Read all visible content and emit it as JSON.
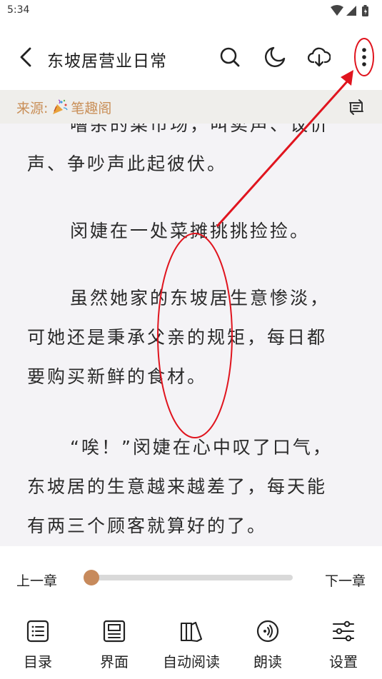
{
  "status_bar": {
    "time": "5:34"
  },
  "header": {
    "title": "东坡居营业日常"
  },
  "source": {
    "label": "来源:",
    "name": "笔趣阁"
  },
  "content": {
    "paragraphs": [
      "嘈杂的菜市场，叫卖声、议价",
      "声、争吵声此起彼伏。",
      "闵婕在一处菜摊挑挑捡捡。",
      "虽然她家的东坡居生意惨淡，",
      "可她还是秉承父亲的规矩，每日都",
      "要购买新鲜的食材。",
      "“唉！”闵婕在心中叹了口气，",
      "东坡居的生意越来越差了，每天能",
      "有两三个顾客就算好的了。"
    ]
  },
  "progress": {
    "prev_label": "上一章",
    "next_label": "下一章",
    "position": 0
  },
  "toolbar": {
    "toc_label": "目录",
    "ui_label": "界面",
    "auto_read_label": "自动阅读",
    "tts_label": "朗读",
    "settings_label": "设置"
  },
  "colors": {
    "accent": "#c78a5c",
    "source_text": "#c98f58",
    "annotation": "#e0141e"
  }
}
